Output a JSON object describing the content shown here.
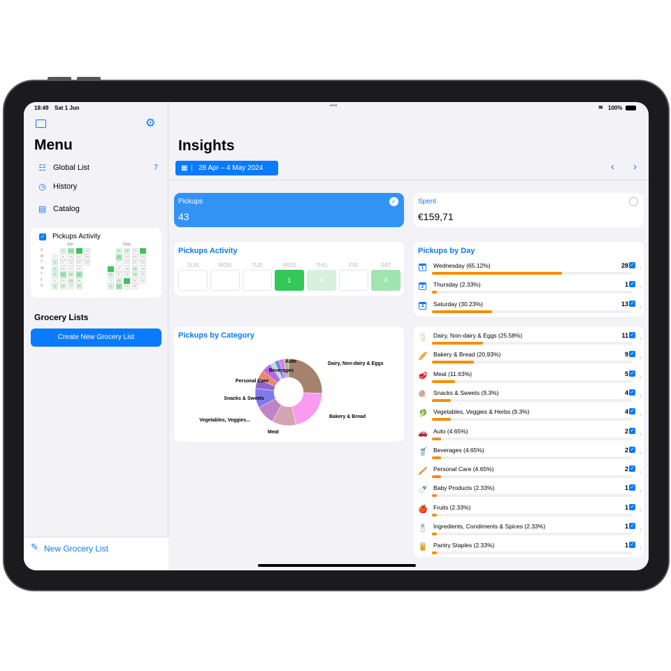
{
  "status": {
    "time": "18:49",
    "date": "Sat 1 Jun",
    "battery": "100%"
  },
  "sidebar": {
    "title": "Menu",
    "items": [
      {
        "label": "Global List",
        "icon": "list-bullet-icon",
        "badge": "7"
      },
      {
        "label": "History",
        "icon": "clock-history-icon"
      },
      {
        "label": "Catalog",
        "icon": "book-icon"
      }
    ],
    "activity_widget": {
      "label": "Pickups Activity",
      "checked": true,
      "weekday_letters": [
        "S",
        "M",
        "T",
        "W",
        "T",
        "F",
        "S"
      ],
      "months": [
        {
          "name": "Apr",
          "weeks": [
            [
              null,
              [
                "1",
                0
              ],
              [
                "2",
                1
              ],
              [
                "3",
                1
              ],
              [
                "4",
                1
              ],
              [
                "5",
                0
              ],
              [
                "6",
                1
              ]
            ],
            [
              [
                "7",
                1
              ],
              [
                "8",
                0
              ],
              [
                "9",
                0
              ],
              [
                "10",
                0
              ],
              [
                "11",
                2
              ],
              [
                "12",
                0
              ],
              [
                "13",
                1
              ]
            ],
            [
              [
                "14",
                2
              ],
              [
                "15",
                0
              ],
              [
                "16",
                0
              ],
              [
                "17",
                0
              ],
              [
                "18",
                1
              ],
              [
                "19",
                1
              ],
              [
                "20",
                0
              ]
            ],
            [
              [
                "21",
                3
              ],
              [
                "22",
                0
              ],
              [
                "23",
                0
              ],
              [
                "24",
                0
              ],
              [
                "25",
                2
              ],
              [
                "26",
                0
              ],
              [
                "27",
                1
              ]
            ],
            [
              [
                "28",
                0
              ],
              [
                "29",
                0
              ],
              [
                "30",
                0
              ]
            ]
          ]
        },
        {
          "name": "May",
          "weeks": [
            [
              null,
              null,
              null,
              [
                "1",
                3
              ],
              [
                "2",
                1
              ],
              [
                "3",
                0
              ],
              [
                "4",
                1
              ]
            ],
            [
              [
                "5",
                1
              ],
              [
                "6",
                2
              ],
              [
                "7",
                0
              ],
              [
                "8",
                0
              ],
              [
                "9",
                0
              ],
              [
                "10",
                1
              ],
              [
                "11",
                2
              ]
            ],
            [
              [
                "12",
                1
              ],
              [
                "13",
                0
              ],
              [
                "14",
                0
              ],
              [
                "15",
                0
              ],
              [
                "16",
                0
              ],
              [
                "17",
                3
              ],
              [
                "18",
                0
              ]
            ],
            [
              [
                "19",
                0
              ],
              [
                "20",
                0
              ],
              [
                "21",
                0
              ],
              [
                "22",
                1
              ],
              [
                "23",
                1
              ],
              [
                "24",
                0
              ],
              [
                "25",
                0
              ]
            ],
            [
              [
                "26",
                3
              ],
              [
                "27",
                0
              ],
              [
                "28",
                0
              ],
              [
                "29",
                0
              ],
              [
                "30",
                0
              ],
              [
                "31",
                0
              ]
            ]
          ]
        }
      ]
    },
    "grocery_lists_title": "Grocery Lists",
    "create_button": "Create New Grocery List",
    "new_list_button": "New Grocery List"
  },
  "main": {
    "title": "Insights",
    "date_range": "28 Apr – 4 May 2024",
    "pickups": {
      "label": "Pickups",
      "value": "43",
      "selected": true
    },
    "spent": {
      "label": "Spent",
      "value": "€159,71",
      "selected": false
    },
    "activity": {
      "title": "Pickups Activity",
      "days": [
        {
          "d": "SUN",
          "v": ""
        },
        {
          "d": "MON",
          "v": ""
        },
        {
          "d": "TUE",
          "v": ""
        },
        {
          "d": "WED",
          "v": "1",
          "color": "#34c759"
        },
        {
          "d": "THU",
          "v": "2",
          "color": "#d6f2dd"
        },
        {
          "d": "FRI",
          "v": ""
        },
        {
          "d": "SAT",
          "v": "4",
          "color": "#a0e4b0"
        }
      ]
    },
    "by_day": {
      "title": "Pickups by Day",
      "rows": [
        {
          "icon": "calendar-1-icon",
          "glyph": "1",
          "label": "Wednesday (65.12%)",
          "count": "28",
          "pct": 65.12
        },
        {
          "icon": "calendar-2-icon",
          "glyph": "2",
          "label": "Thursday (2.33%)",
          "count": "1",
          "pct": 2.33
        },
        {
          "icon": "calendar-4-icon",
          "glyph": "4",
          "label": "Saturday (30.23%)",
          "count": "13",
          "pct": 30.23
        }
      ]
    },
    "by_category": {
      "title": "Pickups by Category"
    },
    "categories": [
      {
        "icon": "milk-icon",
        "glyph": "🥛",
        "label": "Dairy, Non-dairy & Eggs (25.58%)",
        "count": "11",
        "pct": 25.58
      },
      {
        "icon": "bread-icon",
        "glyph": "🥖",
        "label": "Bakery & Bread (20.93%)",
        "count": "9",
        "pct": 20.93
      },
      {
        "icon": "meat-icon",
        "glyph": "🥩",
        "label": "Meat (11.63%)",
        "count": "5",
        "pct": 11.63
      },
      {
        "icon": "lollipop-icon",
        "glyph": "🍭",
        "label": "Snacks & Sweets (9.3%)",
        "count": "4",
        "pct": 9.3
      },
      {
        "icon": "leaf-icon",
        "glyph": "🥬",
        "label": "Vegetables, Veggies & Herbs (9.3%)",
        "count": "4",
        "pct": 9.3
      },
      {
        "icon": "car-icon",
        "glyph": "🚗",
        "label": "Auto (4.65%)",
        "count": "2",
        "pct": 4.65
      },
      {
        "icon": "drink-icon",
        "glyph": "🥤",
        "label": "Beverages (4.65%)",
        "count": "2",
        "pct": 4.65
      },
      {
        "icon": "toothbrush-icon",
        "glyph": "🪥",
        "label": "Personal Care (4.65%)",
        "count": "2",
        "pct": 4.65
      },
      {
        "icon": "baby-bottle-icon",
        "glyph": "🍼",
        "label": "Baby Products (2.33%)",
        "count": "1",
        "pct": 2.33
      },
      {
        "icon": "apple-icon",
        "glyph": "🍎",
        "label": "Fruits (2.33%)",
        "count": "1",
        "pct": 2.33
      },
      {
        "icon": "salt-icon",
        "glyph": "🧂",
        "label": "Ingredients, Condiments & Spices (2.33%)",
        "count": "1",
        "pct": 2.33
      },
      {
        "icon": "can-icon",
        "glyph": "🥫",
        "label": "Pantry Staples (2.33%)",
        "count": "1",
        "pct": 2.33
      }
    ]
  },
  "chart_data": {
    "type": "pie",
    "donut": true,
    "categories": [
      "Dairy, Non-dairy & Eggs",
      "Bakery & Bread",
      "Meat",
      "Vegetables, Veggies...",
      "Snacks & Sweets",
      "Personal Care",
      "Beverages",
      "Auto",
      "Baby Products",
      "Fruits",
      "Ingredients, Condiments & Spices",
      "Pantry Staples"
    ],
    "values": [
      11,
      9,
      5,
      4,
      4,
      2,
      2,
      2,
      1,
      1,
      1,
      1
    ],
    "colors": [
      "#a5826e",
      "#f99bf0",
      "#d4a5b0",
      "#c183c7",
      "#8079ee",
      "#9165c9",
      "#e8896a",
      "#b869e6",
      "#b6e3d9",
      "#8088d4",
      "#d57af5",
      "#aab992"
    ],
    "labels": [
      "Dairy, Non-dairy & Eggs",
      "Bakery & Bread",
      "Meat",
      "Vegetables, Veggies...",
      "Snacks & Sweets",
      "Personal Care",
      "Beverages",
      "Auto"
    ]
  }
}
